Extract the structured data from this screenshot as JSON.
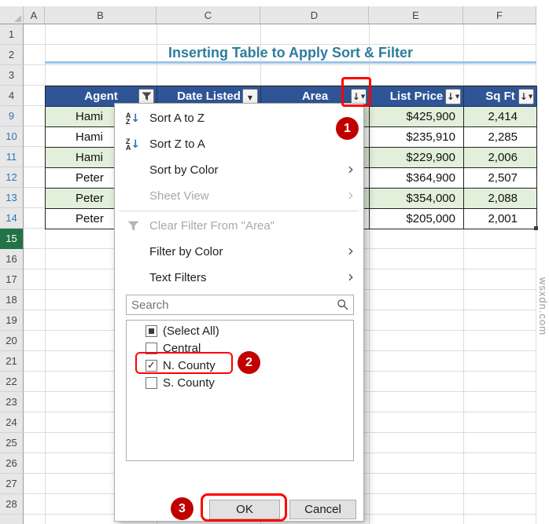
{
  "excel": {
    "column_letters": [
      "A",
      "B",
      "C",
      "D",
      "E",
      "F"
    ],
    "row_numbers": [
      "1",
      "2",
      "3",
      "4",
      "9",
      "10",
      "11",
      "12",
      "13",
      "14",
      "15",
      "16",
      "17",
      "18",
      "19",
      "20",
      "21",
      "22",
      "23",
      "24",
      "25",
      "26",
      "27",
      "28"
    ],
    "title": "Inserting Table to Apply Sort & Filter"
  },
  "table": {
    "headers": {
      "agent": "Agent",
      "date_listed": "Date Listed",
      "area": "Area",
      "list_price": "List Price",
      "sq_ft": "Sq Ft"
    },
    "rows": [
      {
        "agent": "Hami",
        "list_price": "$425,900",
        "sq_ft": "2,414"
      },
      {
        "agent": "Hami",
        "list_price": "$235,910",
        "sq_ft": "2,285"
      },
      {
        "agent": "Hami",
        "list_price": "$229,900",
        "sq_ft": "2,006"
      },
      {
        "agent": "Peter",
        "list_price": "$364,900",
        "sq_ft": "2,507"
      },
      {
        "agent": "Peter",
        "list_price": "$354,000",
        "sq_ft": "2,088"
      },
      {
        "agent": "Peter",
        "list_price": "$205,000",
        "sq_ft": "2,001"
      }
    ]
  },
  "filter_menu": {
    "sort_a_to_z": "Sort A to Z",
    "sort_z_to_a": "Sort Z to A",
    "sort_by_color": "Sort by Color",
    "sheet_view": "Sheet View",
    "clear_filter": "Clear Filter From \"Area\"",
    "filter_by_color": "Filter by Color",
    "text_filters": "Text Filters",
    "search_placeholder": "Search",
    "options": [
      {
        "label": "(Select All)",
        "state": "indeterminate"
      },
      {
        "label": "Central",
        "state": "unchecked"
      },
      {
        "label": "N. County",
        "state": "checked"
      },
      {
        "label": "S. County",
        "state": "unchecked"
      }
    ],
    "ok": "OK",
    "cancel": "Cancel"
  },
  "annotations": {
    "step1": "1",
    "step2": "2",
    "step3": "3"
  },
  "watermark": "wsxdn.com",
  "colors": {
    "table_header_fill": "#2F5597",
    "banded_row_fill": "#E2EFDA",
    "title_color": "#2E7D9C",
    "annotation_circle_red": "#C00000",
    "highlight_box_red": "#FF0000",
    "filtered_row_number_blue": "#2E75B6",
    "selected_row_header_green": "#217346"
  }
}
